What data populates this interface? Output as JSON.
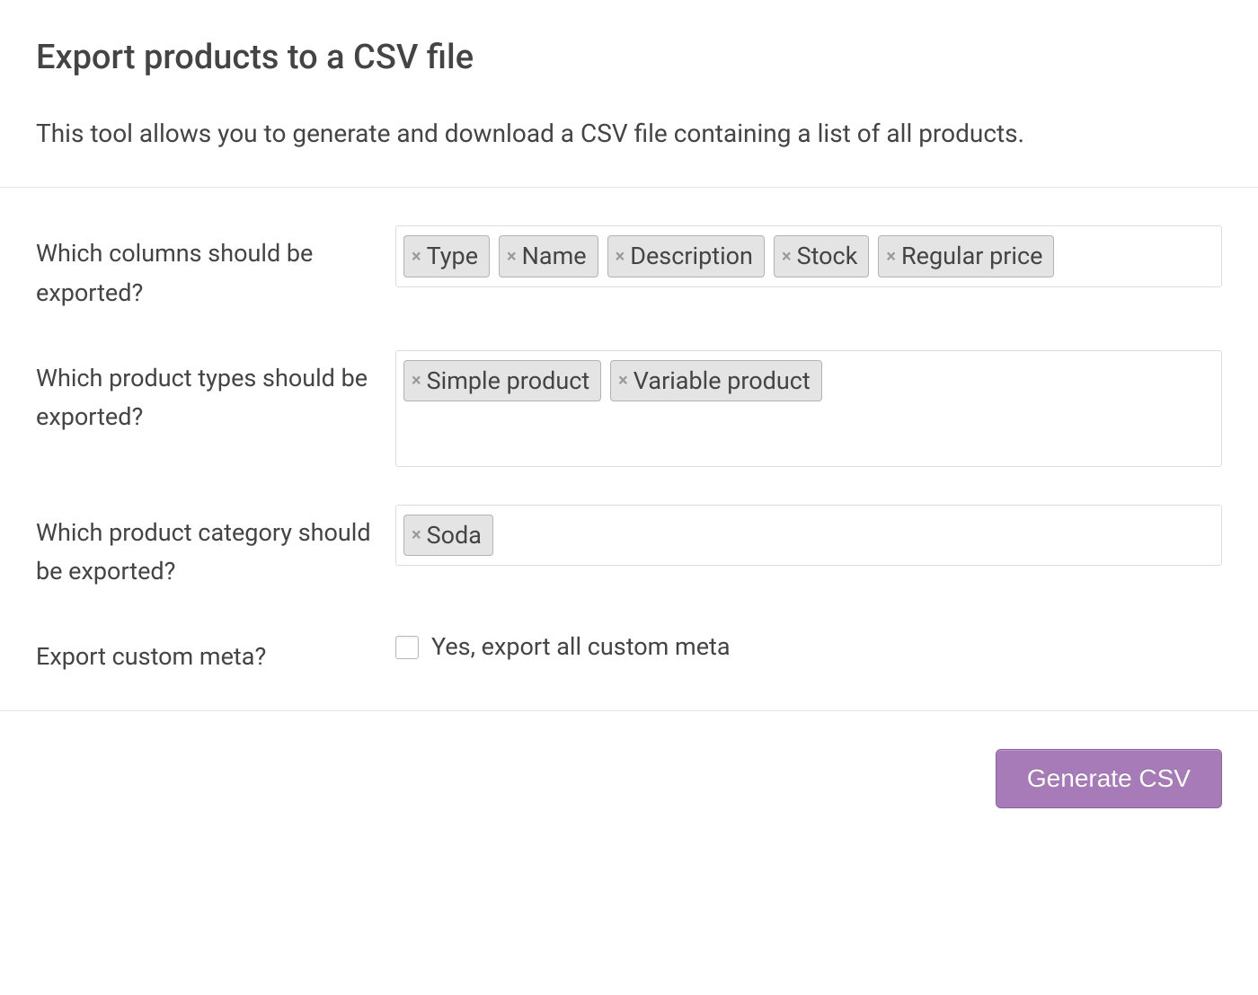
{
  "header": {
    "title": "Export products to a CSV file",
    "description": "This tool allows you to generate and download a CSV file containing a list of all products."
  },
  "form": {
    "columns": {
      "label": "Which columns should be exported?",
      "tags": [
        "Type",
        "Name",
        "Description",
        "Stock",
        "Regular price"
      ]
    },
    "product_types": {
      "label": "Which product types should be exported?",
      "tags": [
        "Simple product",
        "Variable product"
      ]
    },
    "category": {
      "label": "Which product category should be exported?",
      "tags": [
        "Soda"
      ]
    },
    "custom_meta": {
      "label": "Export custom meta?",
      "checkbox_label": "Yes, export all custom meta",
      "checked": false
    }
  },
  "footer": {
    "generate_button": "Generate CSV"
  }
}
